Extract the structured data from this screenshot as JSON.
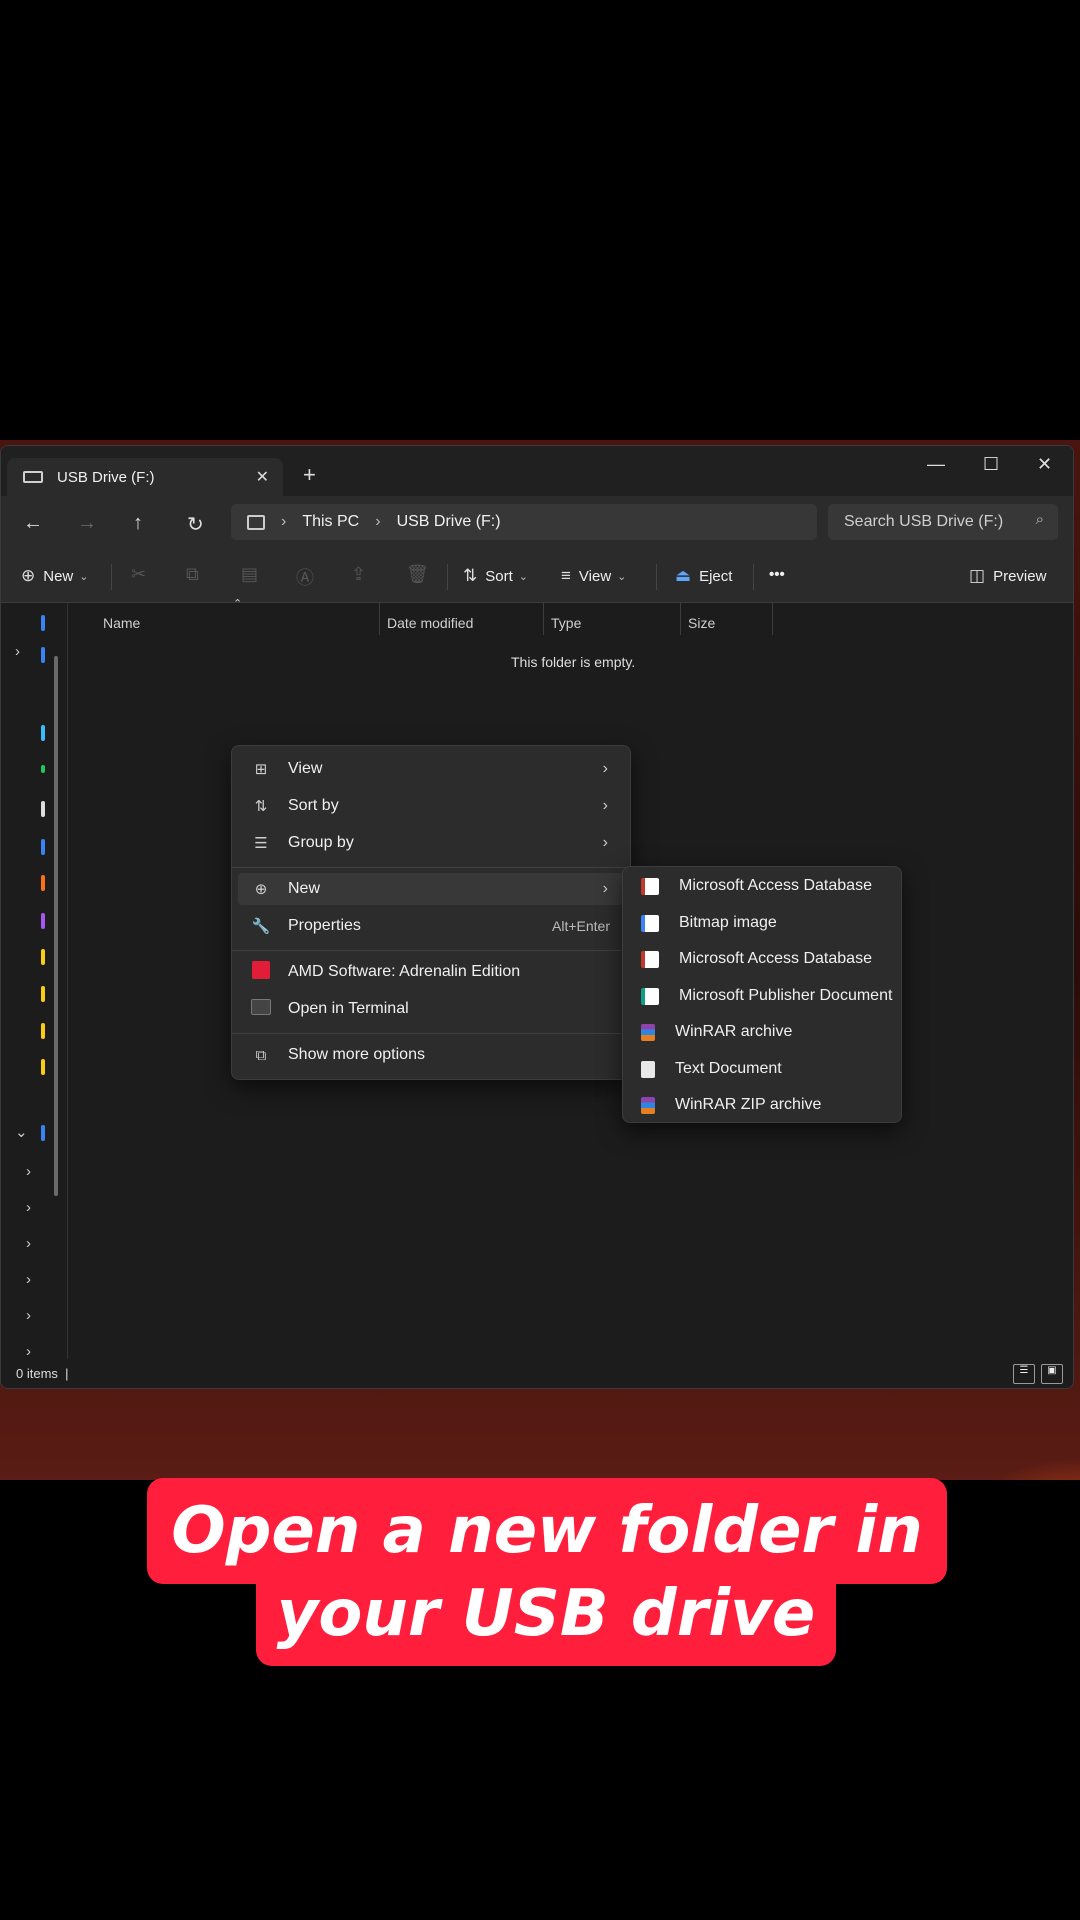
{
  "window": {
    "tab_title": "USB Drive (F:)",
    "new_tab": "+",
    "minimize": "—",
    "maximize": "☐",
    "close": "✕"
  },
  "address": {
    "segments": [
      "This PC",
      "USB Drive (F:)"
    ],
    "search_placeholder": "Search USB Drive (F:)"
  },
  "toolbar": {
    "new_label": "New",
    "sort_label": "Sort",
    "view_label": "View",
    "eject_label": "Eject",
    "more_label": "•••",
    "preview_label": "Preview"
  },
  "columns": [
    "Name",
    "Date modified",
    "Type",
    "Size"
  ],
  "empty_message": "This folder is empty.",
  "status": {
    "item_count": "0 items"
  },
  "context_menu": {
    "items": [
      {
        "label": "View",
        "icon": "grid-icon"
      },
      {
        "label": "Sort by",
        "icon": "sort-icon"
      },
      {
        "label": "Group by",
        "icon": "list-icon"
      },
      {
        "label": "New",
        "icon": "plus-circle-icon"
      },
      {
        "label": "Properties",
        "icon": "wrench-icon",
        "shortcut": "Alt+Enter"
      },
      {
        "label": "AMD Software: Adrenalin Edition",
        "icon": "amd-icon"
      },
      {
        "label": "Open in Terminal",
        "icon": "terminal-icon"
      },
      {
        "label": "Show more options",
        "icon": "expand-icon"
      }
    ]
  },
  "new_submenu": {
    "items": [
      {
        "label": "Microsoft Access Database",
        "icon": "access-icon"
      },
      {
        "label": "Bitmap image",
        "icon": "bitmap-icon"
      },
      {
        "label": "Microsoft Access Database",
        "icon": "access-icon"
      },
      {
        "label": "Microsoft Publisher Document",
        "icon": "publisher-icon"
      },
      {
        "label": "WinRAR archive",
        "icon": "winrar-icon"
      },
      {
        "label": "Text Document",
        "icon": "text-doc-icon"
      },
      {
        "label": "WinRAR ZIP archive",
        "icon": "winrar-icon"
      }
    ]
  },
  "caption": {
    "line1": "Open a new folder in",
    "line2": "your USB drive",
    "color": "#ff1f3d"
  }
}
